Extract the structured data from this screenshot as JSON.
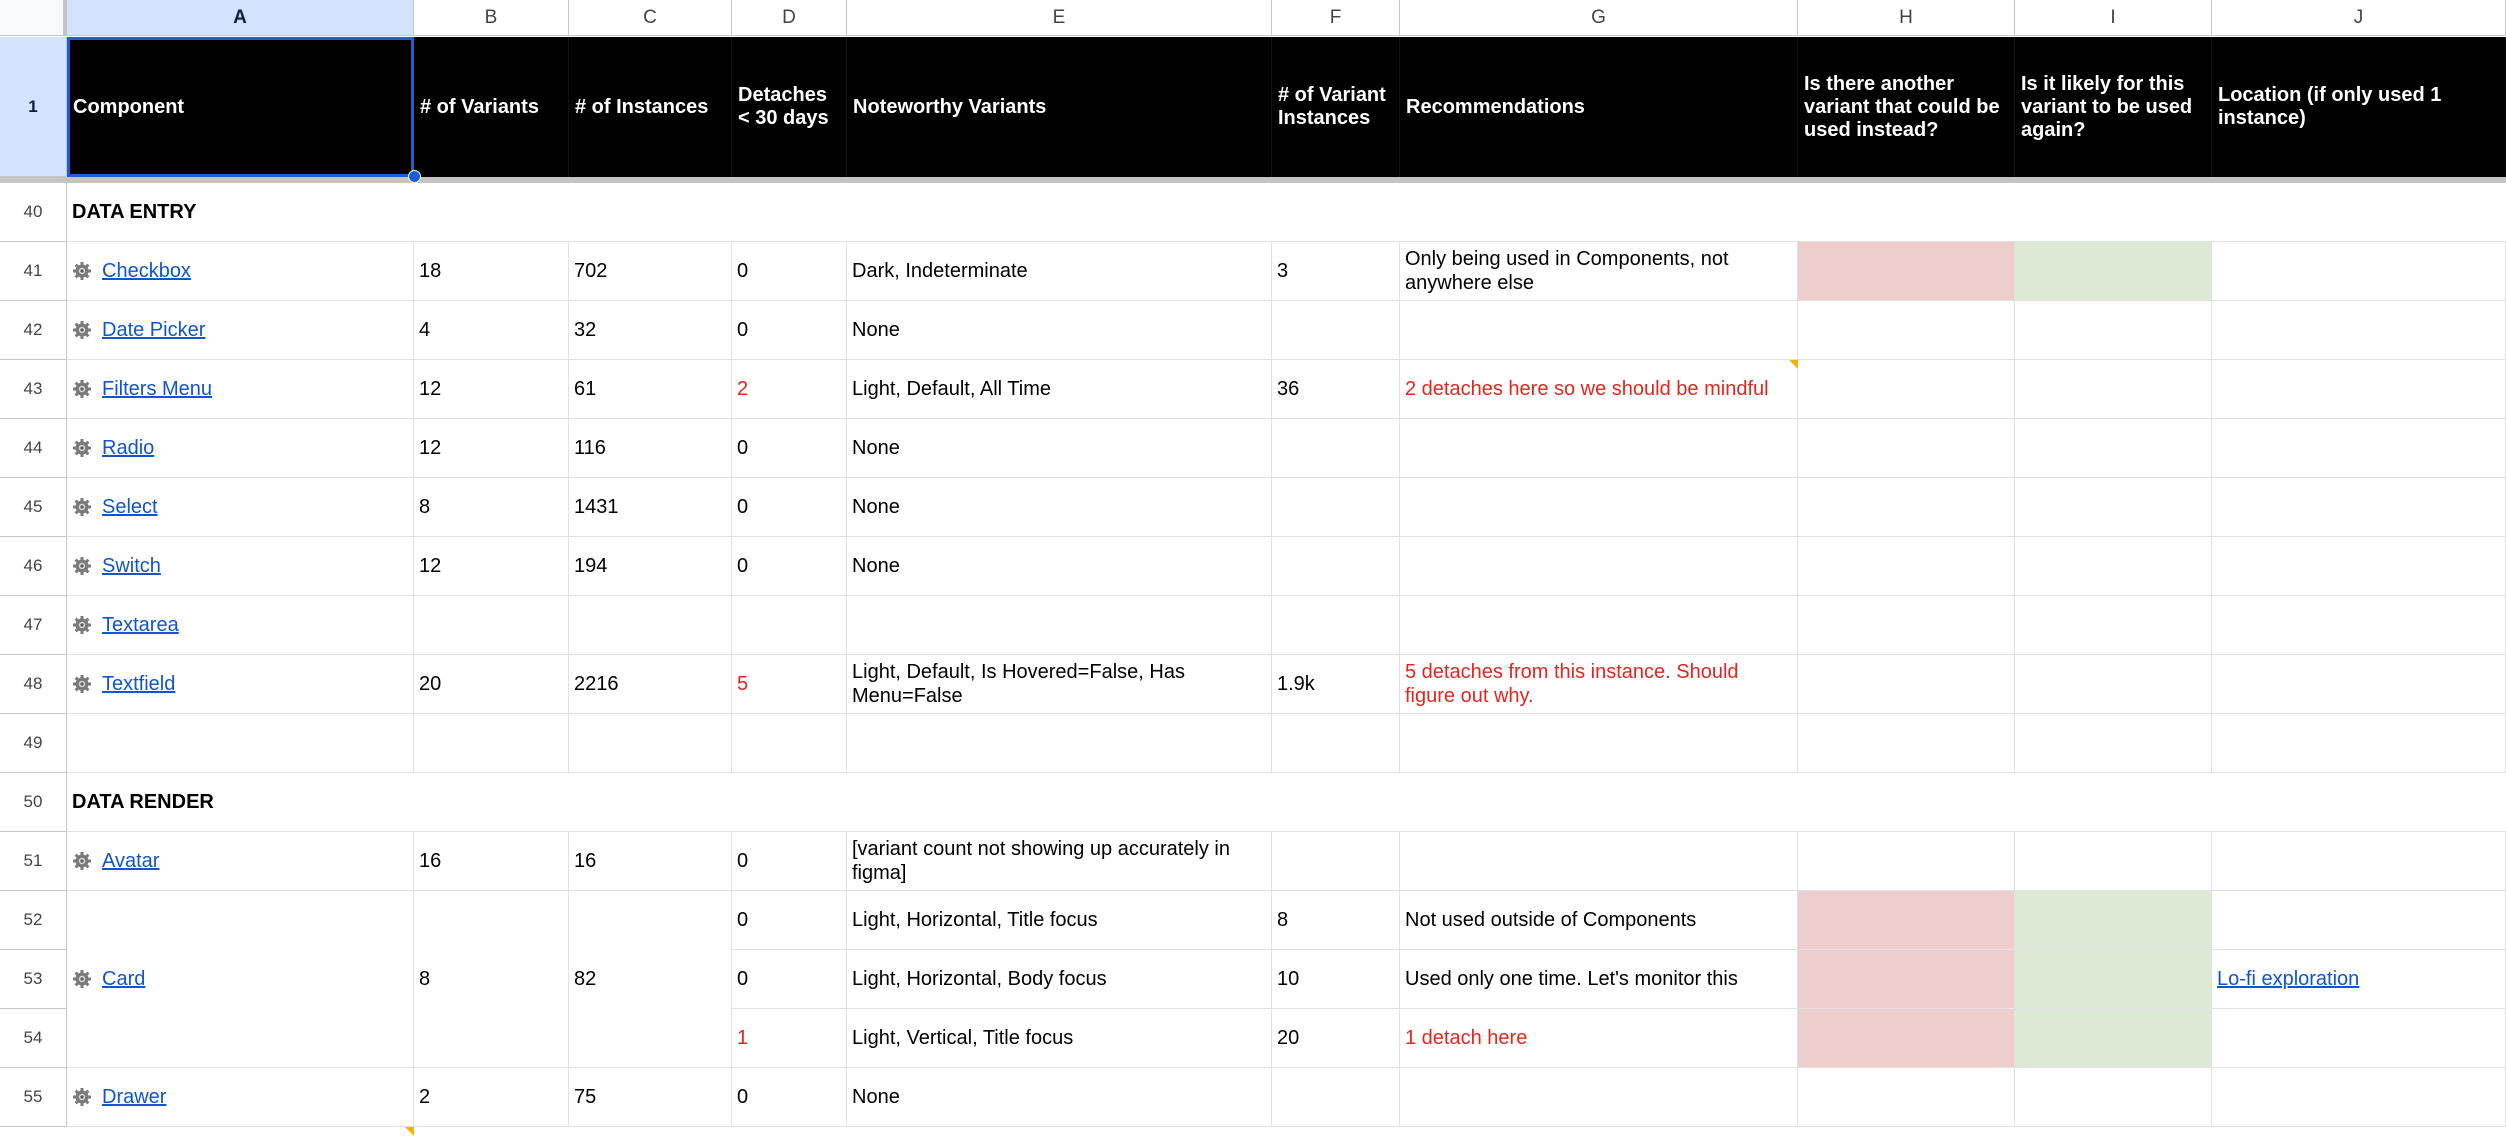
{
  "column_headers": [
    "A",
    "B",
    "C",
    "D",
    "E",
    "F",
    "G",
    "H",
    "I",
    "J"
  ],
  "header_row": {
    "row_number": "1",
    "labels": [
      "Component",
      "# of Variants",
      "# of Instances",
      "Detaches < 30 days",
      "Noteworthy Variants",
      "# of Variant Instances",
      "Recommendations",
      "Is there another variant that could be used instead?",
      "Is it likely for this variant to be used again?",
      "Location (if only used 1 instance)"
    ]
  },
  "sections": {
    "data_entry": {
      "row_number": "40",
      "label": "DATA ENTRY"
    },
    "data_render": {
      "row_number": "50",
      "label": "DATA RENDER"
    }
  },
  "rows": [
    {
      "row_number": "41",
      "component": "Checkbox",
      "variants": "18",
      "instances": "702",
      "detaches": "0",
      "noteworthy": "Dark, Indeterminate",
      "variant_instances": "3",
      "recommendation": "Only being used in Components, not anywhere else",
      "location": ""
    },
    {
      "row_number": "42",
      "component": "Date Picker",
      "variants": "4",
      "instances": "32",
      "detaches": "0",
      "noteworthy": "None",
      "variant_instances": "",
      "recommendation": "",
      "location": ""
    },
    {
      "row_number": "43",
      "component": "Filters Menu",
      "variants": "12",
      "instances": "61",
      "detaches": "2",
      "noteworthy": "Light, Default, All Time",
      "variant_instances": "36",
      "recommendation": "2 detaches here so we should be mindful",
      "location": ""
    },
    {
      "row_number": "44",
      "component": "Radio",
      "variants": "12",
      "instances": "116",
      "detaches": "0",
      "noteworthy": "None",
      "variant_instances": "",
      "recommendation": "",
      "location": ""
    },
    {
      "row_number": "45",
      "component": "Select",
      "variants": "8",
      "instances": "1431",
      "detaches": "0",
      "noteworthy": "None",
      "variant_instances": "",
      "recommendation": "",
      "location": ""
    },
    {
      "row_number": "46",
      "component": "Switch",
      "variants": "12",
      "instances": "194",
      "detaches": "0",
      "noteworthy": "None",
      "variant_instances": "",
      "recommendation": "",
      "location": ""
    },
    {
      "row_number": "47",
      "component": "Textarea",
      "variants": "",
      "instances": "",
      "detaches": "",
      "noteworthy": "",
      "variant_instances": "",
      "recommendation": "",
      "location": ""
    },
    {
      "row_number": "48",
      "component": "Textfield",
      "variants": "20",
      "instances": "2216",
      "detaches": "5",
      "noteworthy": "Light, Default, Is Hovered=False, Has Menu=False",
      "variant_instances": "1.9k",
      "recommendation": "5 detaches from this instance. Should figure out why.",
      "location": ""
    },
    {
      "row_number": "49",
      "component": "",
      "variants": "",
      "instances": "",
      "detaches": "",
      "noteworthy": "",
      "variant_instances": "",
      "recommendation": "",
      "location": ""
    },
    {
      "row_number": "51",
      "component": "Avatar",
      "variants": "16",
      "instances": "16",
      "detaches": "0",
      "noteworthy": "[variant count not showing up accurately in figma]",
      "variant_instances": "",
      "recommendation": "",
      "location": ""
    }
  ],
  "card": {
    "component": "Card",
    "variants": "8",
    "instances": "82",
    "sub_rows": [
      {
        "row_number": "52",
        "detaches": "0",
        "noteworthy": "Light, Horizontal, Title focus",
        "variant_instances": "8",
        "recommendation": "Not used outside of Components",
        "location": ""
      },
      {
        "row_number": "53",
        "detaches": "0",
        "noteworthy": "Light, Horizontal, Body focus",
        "variant_instances": "10",
        "recommendation": "Used only one time. Let's monitor this",
        "location": "Lo-fi exploration"
      },
      {
        "row_number": "54",
        "detaches": "1",
        "noteworthy": "Light, Vertical, Title focus",
        "variant_instances": "20",
        "recommendation": "1 detach here",
        "location": ""
      }
    ]
  },
  "drawer": {
    "row_number": "55",
    "component": "Drawer",
    "variants": "2",
    "instances": "75",
    "detaches": "0",
    "noteworthy": "None",
    "variant_instances": "",
    "recommendation": "",
    "location": ""
  },
  "colors": {
    "negative": "#eecdcd",
    "positive": "#dce9d5",
    "alert_text": "#e3261f",
    "link": "#1155cc",
    "selection": "#1a5fd8"
  }
}
